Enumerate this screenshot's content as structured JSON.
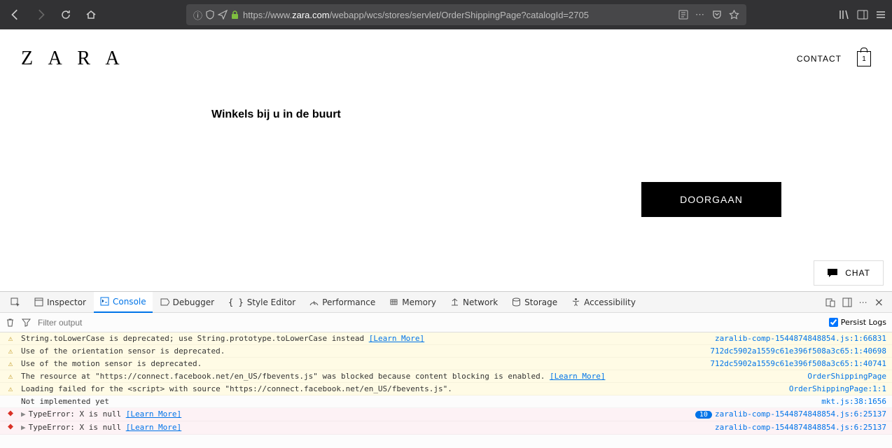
{
  "browser": {
    "url_pre": "https://www.",
    "url_domain": "zara.com",
    "url_rest": "/webapp/wcs/stores/servlet/OrderShippingPage?catalogId=2705",
    "ellipsis": "⋯"
  },
  "page": {
    "logo": "Z A R A",
    "contact": "CONTACT",
    "bag_count": "1",
    "title": "Winkels bij u in de buurt",
    "continue": "DOORGAAN",
    "chat": "CHAT"
  },
  "devtools": {
    "tabs": {
      "inspector": "Inspector",
      "console": "Console",
      "debugger": "Debugger",
      "style": "Style Editor",
      "performance": "Performance",
      "memory": "Memory",
      "network": "Network",
      "storage": "Storage",
      "accessibility": "Accessibility"
    },
    "filter_placeholder": "Filter output",
    "persist": "Persist Logs",
    "learn_more": "[Learn More]",
    "badge10": "10",
    "rows": {
      "r0_msg": "String.toLowerCase is deprecated; use String.prototype.toLowerCase instead ",
      "r0_src": "zaralib-comp-1544874848854.js:1:66831",
      "r1_msg": "Use of the orientation sensor is deprecated.",
      "r1_src": "712dc5902a1559c61e396f508a3c65:1:40698",
      "r2_msg": "Use of the motion sensor is deprecated.",
      "r2_src": "712dc5902a1559c61e396f508a3c65:1:40741",
      "r3_msg": "The resource at \"https://connect.facebook.net/en_US/fbevents.js\" was blocked because content blocking is enabled. ",
      "r3_src": "OrderShippingPage",
      "r4_msg": "Loading failed for the <script> with source \"https://connect.facebook.net/en_US/fbevents.js\".",
      "r4_src": "OrderShippingPage:1:1",
      "r5_msg": "Not implemented yet",
      "r5_src": "mkt.js:38:1656",
      "r6_msg": "TypeError: X is null ",
      "r6_src": "zaralib-comp-1544874848854.js:6:25137",
      "r7_msg": "TypeError: X is null ",
      "r7_src": "zaralib-comp-1544874848854.js:6:25137"
    }
  }
}
